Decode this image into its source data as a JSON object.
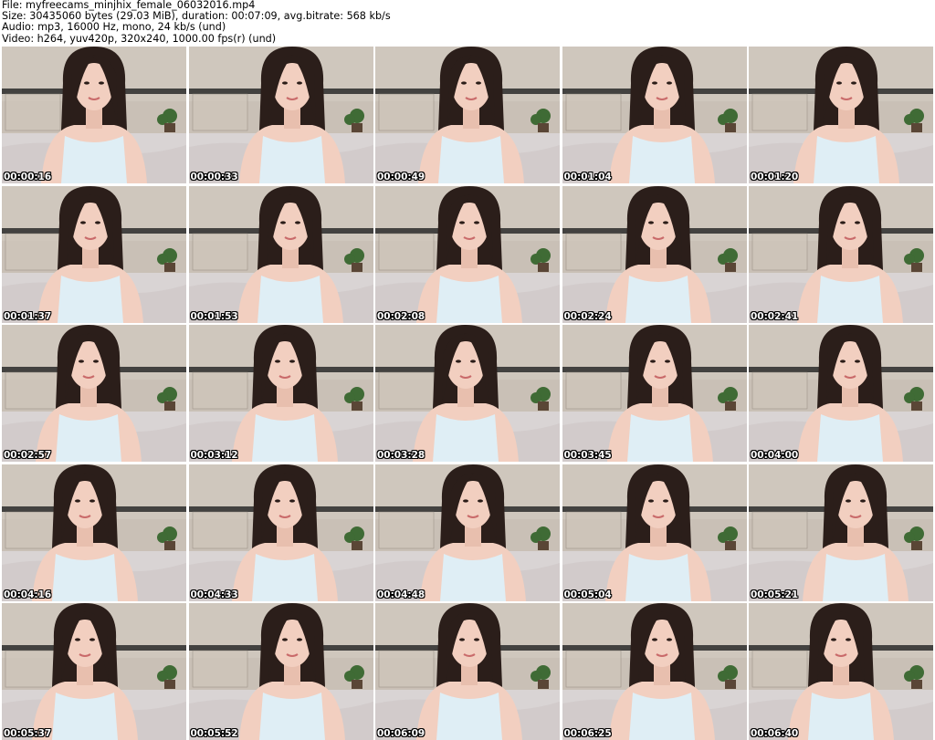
{
  "header": {
    "file_line": "File: myfreecams_minjhix_female_06032016.mp4",
    "size_line": "Size: 30435060 bytes (29.03 MiB), duration: 00:07:09, avg.bitrate: 568 kb/s",
    "audio_line": "Audio: mp3, 16000 Hz, mono, 24 kb/s (und)",
    "video_line": "Video: h264, yuv420p, 320x240, 1000.00 fps(r) (und)"
  },
  "thumbnails": [
    {
      "timestamp": "00:00:16"
    },
    {
      "timestamp": "00:00:33"
    },
    {
      "timestamp": "00:00:49"
    },
    {
      "timestamp": "00:01:04"
    },
    {
      "timestamp": "00:01:20"
    },
    {
      "timestamp": "00:01:37"
    },
    {
      "timestamp": "00:01:53"
    },
    {
      "timestamp": "00:02:08"
    },
    {
      "timestamp": "00:02:24"
    },
    {
      "timestamp": "00:02:41"
    },
    {
      "timestamp": "00:02:57"
    },
    {
      "timestamp": "00:03:12"
    },
    {
      "timestamp": "00:03:28"
    },
    {
      "timestamp": "00:03:45"
    },
    {
      "timestamp": "00:04:00"
    },
    {
      "timestamp": "00:04:16"
    },
    {
      "timestamp": "00:04:33"
    },
    {
      "timestamp": "00:04:48"
    },
    {
      "timestamp": "00:05:04"
    },
    {
      "timestamp": "00:05:21"
    },
    {
      "timestamp": "00:05:37"
    },
    {
      "timestamp": "00:05:52"
    },
    {
      "timestamp": "00:06:09"
    },
    {
      "timestamp": "00:06:25"
    },
    {
      "timestamp": "00:06:40"
    }
  ],
  "colors": {
    "wall": "#c9c0b6",
    "headboard": "#2a2a2a",
    "bedding": "#d9d4d4",
    "skin": "#f2cfc0",
    "hair": "#2b1e1a",
    "top": "#dfeef5",
    "plant": "#3f6b35",
    "timestamp_text": "#ffffff",
    "timestamp_outline": "#000000"
  }
}
